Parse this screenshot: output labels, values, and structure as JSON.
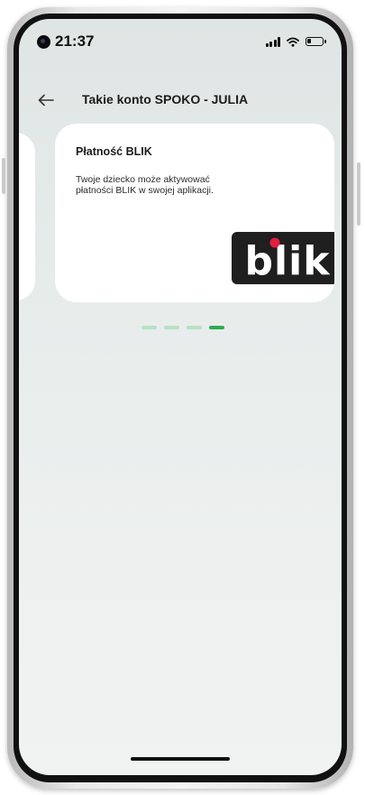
{
  "status_bar": {
    "time": "21:37"
  },
  "header": {
    "title": "Takie konto SPOKO - JULIA"
  },
  "card": {
    "title": "Płatność BLIK",
    "description": "Twoje dziecko może aktywować płatności BLIK w swojej aplikacji.",
    "logo_text": "blik"
  },
  "pager": {
    "total": 4,
    "active_index": 3
  },
  "colors": {
    "accent_green": "#2dab55",
    "inactive_dot": "#b7e0c8",
    "blik_background": "#1f1f1f",
    "blik_dot": "#e41e3f"
  }
}
